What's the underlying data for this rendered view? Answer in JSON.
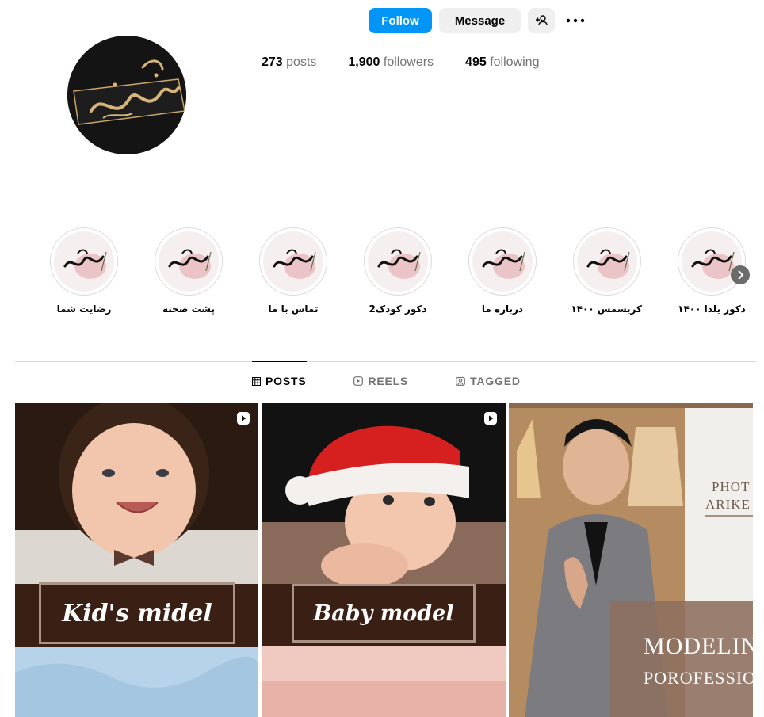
{
  "header": {
    "follow_label": "Follow",
    "message_label": "Message",
    "add_user_icon": "add-person-icon",
    "more_icon": "more-horizontal-icon"
  },
  "stats": {
    "posts_count": "273",
    "posts_label": "posts",
    "followers_count": "1,900",
    "followers_label": "followers",
    "following_count": "495",
    "following_label": "following"
  },
  "highlights": [
    {
      "label": "رضایت شما"
    },
    {
      "label": "پشت صحنه"
    },
    {
      "label": "تماس با ما"
    },
    {
      "label": "دکور کودک2"
    },
    {
      "label": "درباره ما"
    },
    {
      "label": "کریسمس ۱۴۰۰"
    },
    {
      "label": "دکور یلدا ۱۴۰۰"
    }
  ],
  "tabs": [
    {
      "label": "POSTS",
      "icon": "grid-icon",
      "active": true
    },
    {
      "label": "REELS",
      "icon": "reels-icon",
      "active": false
    },
    {
      "label": "TAGGED",
      "icon": "tagged-icon",
      "active": false
    }
  ],
  "posts": [
    {
      "caption": "Kid's midel",
      "type": "reel"
    },
    {
      "caption": "Baby model",
      "type": "reel"
    },
    {
      "text_line1": "PHOT",
      "text_line2": "ARIKE",
      "text_line3": "MODELING",
      "text_line4": "POROFESSIONA",
      "type": "post"
    }
  ],
  "colors": {
    "accent": "#0095f6",
    "button_bg": "#efefef",
    "muted_text": "#737373",
    "divider": "#dbdbdb",
    "caption_band": "#3a1f14"
  }
}
